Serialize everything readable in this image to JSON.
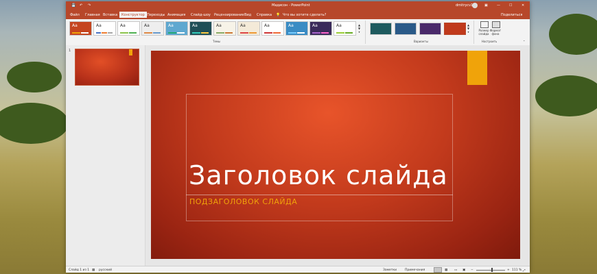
{
  "window": {
    "title": "Мадисон - PowerPoint",
    "user": "dmitrycv1",
    "tell_me": "Что вы хотите сделать?",
    "share": "Поделиться"
  },
  "tabs": [
    "Файл",
    "Главная",
    "Вставка",
    "Конструктор",
    "Переходы",
    "Анимация",
    "Слайд-шоу",
    "Рецензирование",
    "Вид",
    "Справка"
  ],
  "active_tab": "Конструктор",
  "ribbon": {
    "themes_label": "Темы",
    "variants_label": "Варианты",
    "customize_label": "Настроить",
    "slide_size": "Размер слайда",
    "format_bg": "Формат фона",
    "theme_aa": "Aa"
  },
  "slide": {
    "number": "1",
    "title": "Заголовок слайда",
    "subtitle": "ПОДЗАГОЛОВОК СЛАЙДА",
    "accent_color": "#f0a30a",
    "background_color": "#c23a1c"
  },
  "status": {
    "slide_of": "Слайд 1 из 1",
    "language": "русский",
    "notes": "Заметки",
    "comments": "Примечания",
    "zoom": "111 %"
  }
}
